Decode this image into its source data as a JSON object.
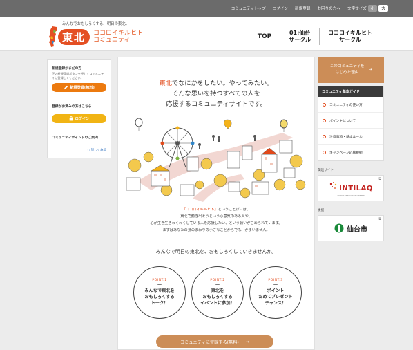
{
  "topbar": {
    "links": [
      "コミュニティトップ",
      "ログイン",
      "新規登録",
      "お困りの方へ"
    ],
    "font_size_label": "文字サイズ",
    "font_small": "小",
    "font_large": "大"
  },
  "header": {
    "tagline": "みんなでおもしろくする、明日の東北。",
    "logo_badge": "東北",
    "logo_line1": "ココロイキルヒト",
    "logo_line2": "コミュニティ",
    "nav": [
      {
        "line1": "TOP",
        "line2": ""
      },
      {
        "line1": "01:仙台",
        "line2": "サークル"
      },
      {
        "line1": "ココロイキルヒト",
        "line2": "サークル"
      }
    ]
  },
  "left_sidebar": {
    "register_title": "新規登録がまだの方",
    "register_desc": "下の新規登録ボタンを押してコミュニティに登録してください。",
    "register_button": "新規登録(無料)",
    "login_title": "登録がお済みの方はこちら",
    "login_button": "ログイン",
    "points_title": "コミュニティポイントのご案内",
    "points_link": "詳しくみる"
  },
  "main": {
    "headline_red": "東北",
    "headline_1": "でなにかをしたい。やってみたい。",
    "headline_2": "そんな思いを持つすべての人を",
    "headline_3": "応援するコミュニティサイトです。",
    "para_red": "「ココロイキルヒト」",
    "para_1": "ということばには、",
    "para_2": "東北で動き出そうという心意気のある人や、",
    "para_3": "心が生き生きわくわくしている人を応援したい、という願いがこめられています。",
    "para_4": "まずはあなたの身のまわりの小さなことからでも、かまいません。",
    "callout": "みんなで明日の東北を、おもしろくしていきませんか。",
    "points": [
      {
        "label": "POINT.1",
        "dash": "ー",
        "l1": "みんなで東北を",
        "l2": "おもしろくする",
        "l3": "トーク！"
      },
      {
        "label": "POINT.2",
        "dash": "ー",
        "l1": "東北を",
        "l2": "おもしろくする",
        "l3": "イベントに参加！"
      },
      {
        "label": "POINT.3",
        "dash": "ー",
        "l1": "ポイント",
        "l2": "ためてプレゼント",
        "l3": "チャンス！"
      }
    ],
    "cta": "コミュニティに登録する(無料)",
    "cta_arrow": "→"
  },
  "right_sidebar": {
    "reason_l1": "このコミュニティを",
    "reason_l2": "はじめた理由",
    "reason_arrow": "→",
    "guide_title": "コミュニティ基本ガイド",
    "guide_items": [
      "コミュニティの使い方",
      "ポイントについて",
      "注意事項・基本ルール",
      "キャンペーン応募規約"
    ],
    "related_label": "関連サイト",
    "intilaq_name": "INTILAQ",
    "intilaq_sub": "TOHOKU INNOVATION CENTER",
    "support_label": "後援",
    "sendai_name": "仙台市"
  },
  "colors": {
    "accent_red": "#e2491a",
    "cta_brown": "#cc8d57",
    "register_orange": "#ec7a0f",
    "login_yellow": "#f1b414",
    "topbar_gray": "#6b6b6b"
  }
}
